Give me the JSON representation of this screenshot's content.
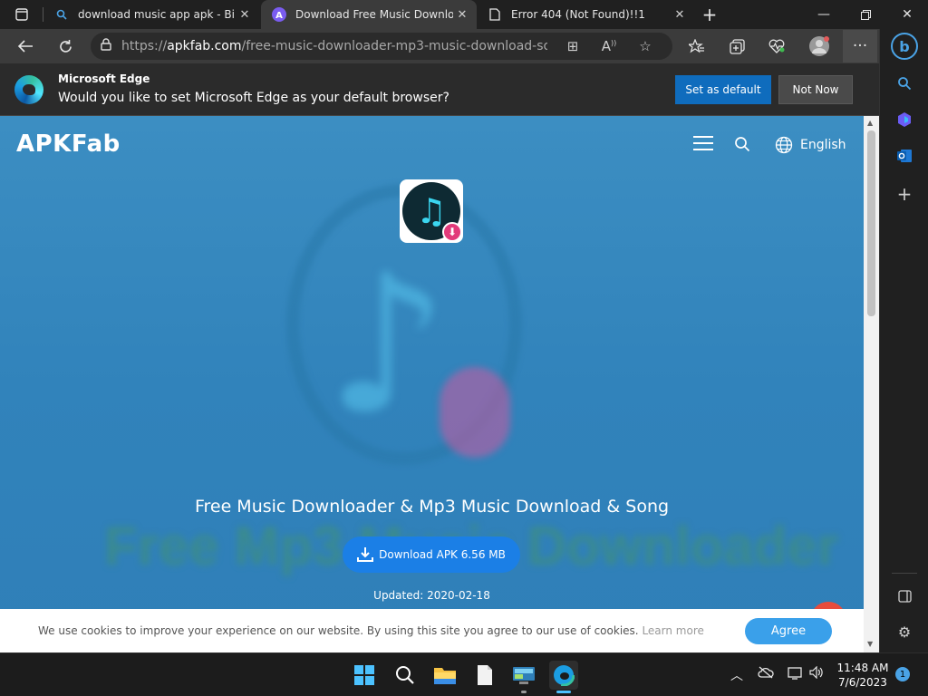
{
  "tabs": [
    {
      "title": "download music app apk - Bing",
      "favicon": "search-icon"
    },
    {
      "title": "Download Free Music Downloader",
      "favicon": "apkfab-icon"
    },
    {
      "title": "Error 404 (Not Found)!!1",
      "favicon": "page-icon"
    }
  ],
  "address": {
    "prefix": "https://",
    "domain": "apkfab.com",
    "path": "/free-music-downloader-mp3-music-download-song/c..."
  },
  "infobar": {
    "title": "Microsoft Edge",
    "message": "Would you like to set Microsoft Edge as your default browser?",
    "set_default": "Set as default",
    "not_now": "Not Now"
  },
  "site": {
    "logo": "APKFab",
    "language": "English",
    "app_title": "Free Music Downloader & Mp3 Music Download & Song",
    "download_label": "Download APK 6.56 MB",
    "updated": "Updated: 2020-02-18",
    "bg_banner_text": "Free Mp3 Music Downloader"
  },
  "cookie": {
    "message": "We use cookies to improve your experience on our website. By using this site you agree to our use of cookies.",
    "learn_more": "Learn more",
    "agree": "Agree"
  },
  "taskbar": {
    "time": "11:48 AM",
    "date": "7/6/2023",
    "notifications": "1"
  },
  "colors": {
    "accent": "#0f6cbd",
    "page_bg": "#3183bb",
    "download_button": "#1b7fe6",
    "agree_button": "#3aa0ea"
  }
}
